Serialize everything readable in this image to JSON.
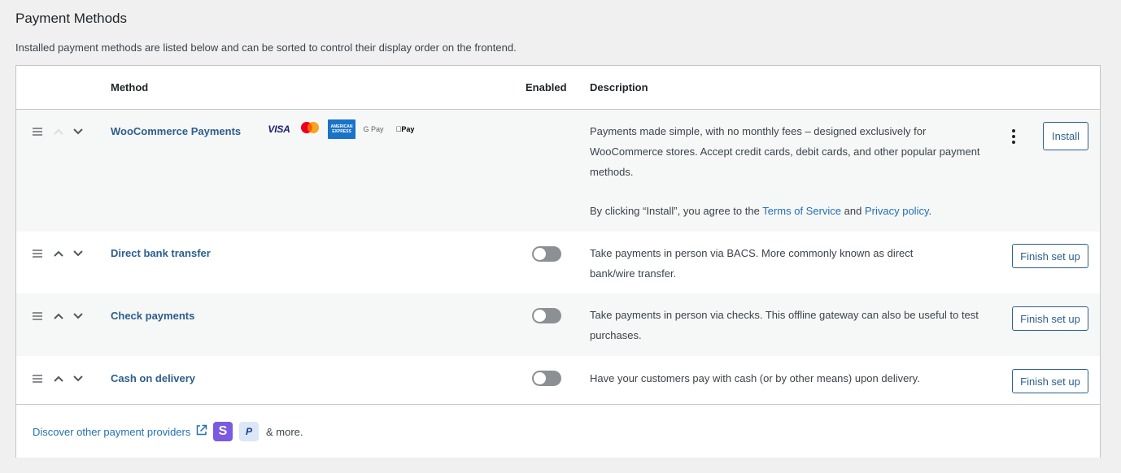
{
  "page": {
    "title": "Payment Methods",
    "description": "Installed payment methods are listed below and can be sorted to control their display order on the frontend."
  },
  "table": {
    "headers": {
      "method": "Method",
      "enabled": "Enabled",
      "description": "Description"
    },
    "rows": [
      {
        "name": "WooCommerce Payments",
        "card_logos": [
          "VISA",
          "Mastercard",
          "American Express",
          "G Pay",
          "Apple Pay"
        ],
        "desc": "Payments made simple, with no monthly fees – designed exclusively for WooCommerce stores. Accept credit cards, debit cards, and other popular payment methods.",
        "agree_prefix": "By clicking “Install”, you agree to the",
        "terms_link": "Terms of Service",
        "and": "and",
        "privacy_link": "Privacy policy",
        "agree_suffix": ".",
        "button": "Install"
      },
      {
        "name": "Direct bank transfer",
        "enabled": false,
        "desc": "Take payments in person via BACS. More commonly known as direct bank/wire transfer.",
        "button": "Finish set up"
      },
      {
        "name": "Check payments",
        "enabled": false,
        "desc": "Take payments in person via checks. This offline gateway can also be useful to test purchases.",
        "button": "Finish set up"
      },
      {
        "name": "Cash on delivery",
        "enabled": false,
        "desc": "Have your customers pay with cash (or by other means) upon delivery.",
        "button": "Finish set up"
      }
    ]
  },
  "footer": {
    "discover_link": "Discover other payment providers",
    "stripe_letter": "S",
    "paypal_letter": "P",
    "more": "& more."
  },
  "colors": {
    "link": "#2c5e8e",
    "toggle_off": "#8c8f94",
    "background": "#f0f0f1"
  }
}
